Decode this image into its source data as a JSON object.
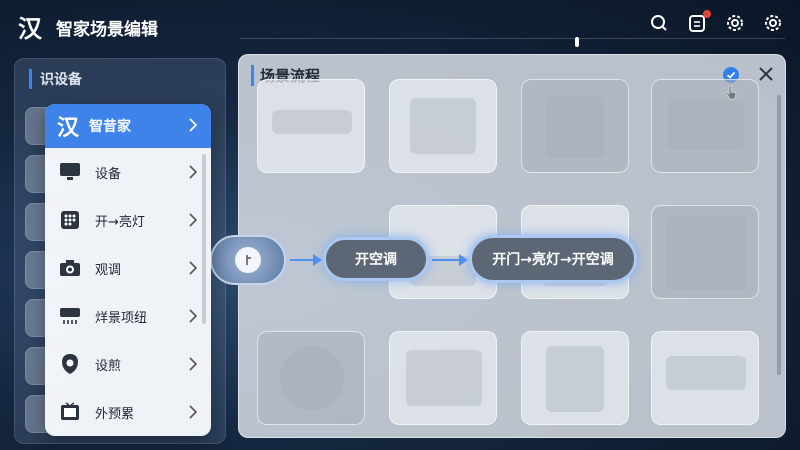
{
  "header": {
    "logo": "汉",
    "title": "智家场景编辑",
    "notification_count": ""
  },
  "left_panel": {
    "title": "识设备"
  },
  "main_panel": {
    "title": "场景流程",
    "confirm_icon": "check-circle-icon",
    "close_icon": "close-icon"
  },
  "flow": {
    "start_icon": "toggle-icon",
    "nodes": [
      {
        "label": "开空调"
      },
      {
        "label": "开门→亮灯→开空调"
      }
    ]
  },
  "menu": {
    "header": {
      "logo": "汉",
      "label": "智昔家"
    },
    "items": [
      {
        "label": "设备",
        "icon": "monitor-icon"
      },
      {
        "label": "开→亮灯",
        "icon": "keypad-icon"
      },
      {
        "label": "观调",
        "icon": "camera-icon"
      },
      {
        "label": "烊景项纽",
        "icon": "air-conditioner-icon"
      },
      {
        "label": "设煎",
        "icon": "shield-icon"
      },
      {
        "label": "外预累",
        "icon": "tv-icon"
      }
    ]
  },
  "colors": {
    "accent": "#3d83ea",
    "background": "#14263f",
    "node": "#5c6675"
  }
}
